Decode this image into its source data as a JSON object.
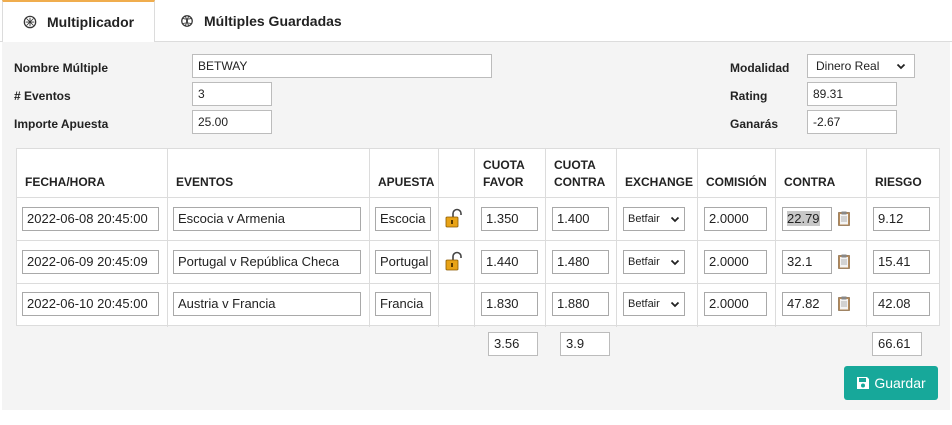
{
  "tabs": [
    {
      "label": "Multiplicador",
      "icon": "calculator-icon",
      "active": true
    },
    {
      "label": "Múltiples Guardadas",
      "icon": "dribbble-icon",
      "active": false
    }
  ],
  "form": {
    "name_label": "Nombre Múltiple",
    "name_value": "BETWAY",
    "events_label": "# Eventos",
    "events_value": "3",
    "stake_label": "Importe Apuesta",
    "stake_value": "25.00",
    "mode_label": "Modalidad",
    "mode_value": "Dinero Real",
    "rating_label": "Rating",
    "rating_value": "89.31",
    "win_label": "Ganarás",
    "win_value": "-2.67"
  },
  "table": {
    "headers": {
      "fecha": "FECHA/HORA",
      "eventos": "EVENTOS",
      "apuesta": "APUESTA",
      "cuota_favor_1": "CUOTA",
      "cuota_favor_2": "FAVOR",
      "cuota_contra_1": "CUOTA",
      "cuota_contra_2": "CONTRA",
      "exchange": "EXCHANGE",
      "comision": "COMISIÓN",
      "contra": "CONTRA",
      "riesgo": "RIESGO"
    },
    "rows": [
      {
        "fecha": "2022-06-08 20:45:00",
        "evento": "Escocia v Armenia",
        "apuesta": "Escocia",
        "locked": true,
        "cuota_favor": "1.350",
        "cuota_contra": "1.400",
        "exchange": "Betfair",
        "comision": "2.0000",
        "contra": "22.79",
        "riesgo": "9.12"
      },
      {
        "fecha": "2022-06-09 20:45:09",
        "evento": "Portugal v República Checa",
        "apuesta": "Portugal",
        "locked": true,
        "cuota_favor": "1.440",
        "cuota_contra": "1.480",
        "exchange": "Betfair",
        "comision": "2.0000",
        "contra": "32.1",
        "riesgo": "15.41"
      },
      {
        "fecha": "2022-06-10 20:45:00",
        "evento": "Austria v Francia",
        "apuesta": "Francia",
        "locked": false,
        "cuota_favor": "1.830",
        "cuota_contra": "1.880",
        "exchange": "Betfair",
        "comision": "2.0000",
        "contra": "47.82",
        "riesgo": "42.08"
      }
    ],
    "totals": {
      "cuota_favor": "3.56",
      "cuota_contra": "3.9",
      "riesgo": "66.61"
    }
  },
  "actions": {
    "save_label": "Guardar"
  },
  "colors": {
    "accent": "#f0ad4e",
    "save_button": "#17a89a",
    "lock": "#e8a317"
  }
}
